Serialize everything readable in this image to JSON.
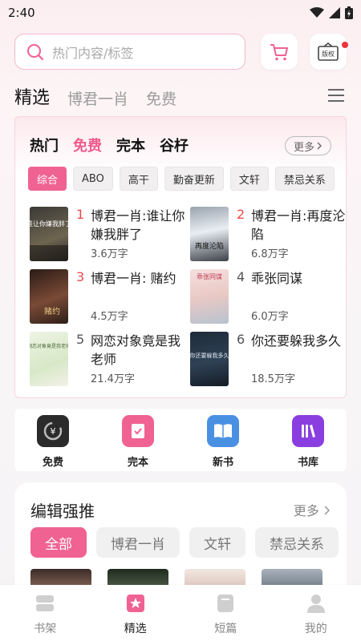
{
  "status": {
    "time": "2:40"
  },
  "search": {
    "placeholder": "热门内容/标签"
  },
  "header": {
    "copyright_label": "版权"
  },
  "tabs": [
    {
      "label": "精选"
    },
    {
      "label": "博君一肖"
    },
    {
      "label": "免费"
    }
  ],
  "ranking": {
    "subtabs": [
      {
        "label": "热门"
      },
      {
        "label": "免费"
      },
      {
        "label": "完本"
      },
      {
        "label": "谷杍"
      }
    ],
    "more_label": "更多",
    "chips": [
      {
        "label": "综合"
      },
      {
        "label": "ABO"
      },
      {
        "label": "高干"
      },
      {
        "label": "勤奋更新"
      },
      {
        "label": "文轩"
      },
      {
        "label": "禁忌关系"
      }
    ],
    "books": [
      {
        "rank": "1",
        "title": "博君一肖:谁让你嫌我胖了",
        "count": "3.6万字",
        "cover_text": "谁让你嫌我胖了"
      },
      {
        "rank": "2",
        "title": "博君一肖:再度沦陷",
        "count": "6.8万字",
        "cover_text": "再度沦陷"
      },
      {
        "rank": "3",
        "title": "博君一肖: 赌约",
        "count": "4.5万字",
        "cover_text": "赌约"
      },
      {
        "rank": "4",
        "title": "乖张同谋",
        "count": "6.0万字",
        "cover_text": "乖张同谋"
      },
      {
        "rank": "5",
        "title": "网恋对象竟是我老师",
        "count": "21.4万字",
        "cover_text": "网恋对象竟是我老师"
      },
      {
        "rank": "6",
        "title": "你还要躲我多久",
        "count": "18.5万字",
        "cover_text": "你还要躲我多久"
      }
    ]
  },
  "quick": [
    {
      "label": "免费",
      "icon": "yuan-icon"
    },
    {
      "label": "完本",
      "icon": "check-book-icon"
    },
    {
      "label": "新书",
      "icon": "open-book-icon"
    },
    {
      "label": "书库",
      "icon": "library-icon"
    }
  ],
  "picks": {
    "title": "编辑强推",
    "more_label": "更多",
    "chips": [
      {
        "label": "全部"
      },
      {
        "label": "博君一肖"
      },
      {
        "label": "文轩"
      },
      {
        "label": "禁忌关系"
      }
    ]
  },
  "bottomnav": [
    {
      "label": "书架"
    },
    {
      "label": "精选"
    },
    {
      "label": "短篇"
    },
    {
      "label": "我的"
    }
  ],
  "colors": {
    "accent": "#f06292",
    "rank_hot": "#ec4a4a"
  }
}
